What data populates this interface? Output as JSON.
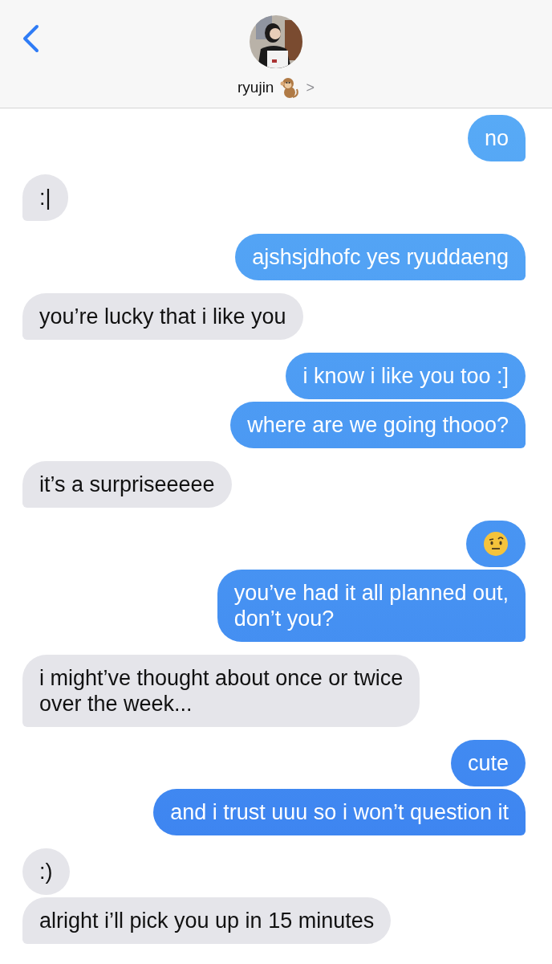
{
  "header": {
    "contact_name": "ryujin",
    "chevron": ">"
  },
  "messages": [
    {
      "outgoing": true,
      "kind": "text",
      "text": "no",
      "tail": true
    },
    {
      "outgoing": false,
      "kind": "text",
      "text": ":|",
      "tail": true
    },
    {
      "outgoing": true,
      "kind": "text",
      "text": "ajshsjdhofc yes ryuddaeng",
      "tail": true
    },
    {
      "outgoing": false,
      "kind": "text",
      "text": "you’re lucky that i like you",
      "tail": true
    },
    {
      "outgoing": true,
      "kind": "text",
      "text": "i know i like you too :]",
      "tail": false
    },
    {
      "outgoing": true,
      "kind": "text",
      "text": "where are we going thooo?",
      "tail": true
    },
    {
      "outgoing": false,
      "kind": "text",
      "text": "it’s a surpriseeeee",
      "tail": true
    },
    {
      "outgoing": true,
      "kind": "emoji",
      "tail": false
    },
    {
      "outgoing": true,
      "kind": "text",
      "text": "you’ve had it all planned out,\ndon’t you?",
      "tail": true
    },
    {
      "outgoing": false,
      "kind": "text",
      "text": "i might’ve thought about once or twice\nover the week...",
      "tail": true
    },
    {
      "outgoing": true,
      "kind": "text",
      "text": "cute",
      "tail": false
    },
    {
      "outgoing": true,
      "kind": "text",
      "text": "and i trust uuu so i won’t question it",
      "tail": true
    },
    {
      "outgoing": false,
      "kind": "text",
      "text": ":)",
      "tail": false
    },
    {
      "outgoing": false,
      "kind": "text",
      "text": "alright i’ll pick you up in 15 minutes",
      "tail": true
    }
  ]
}
